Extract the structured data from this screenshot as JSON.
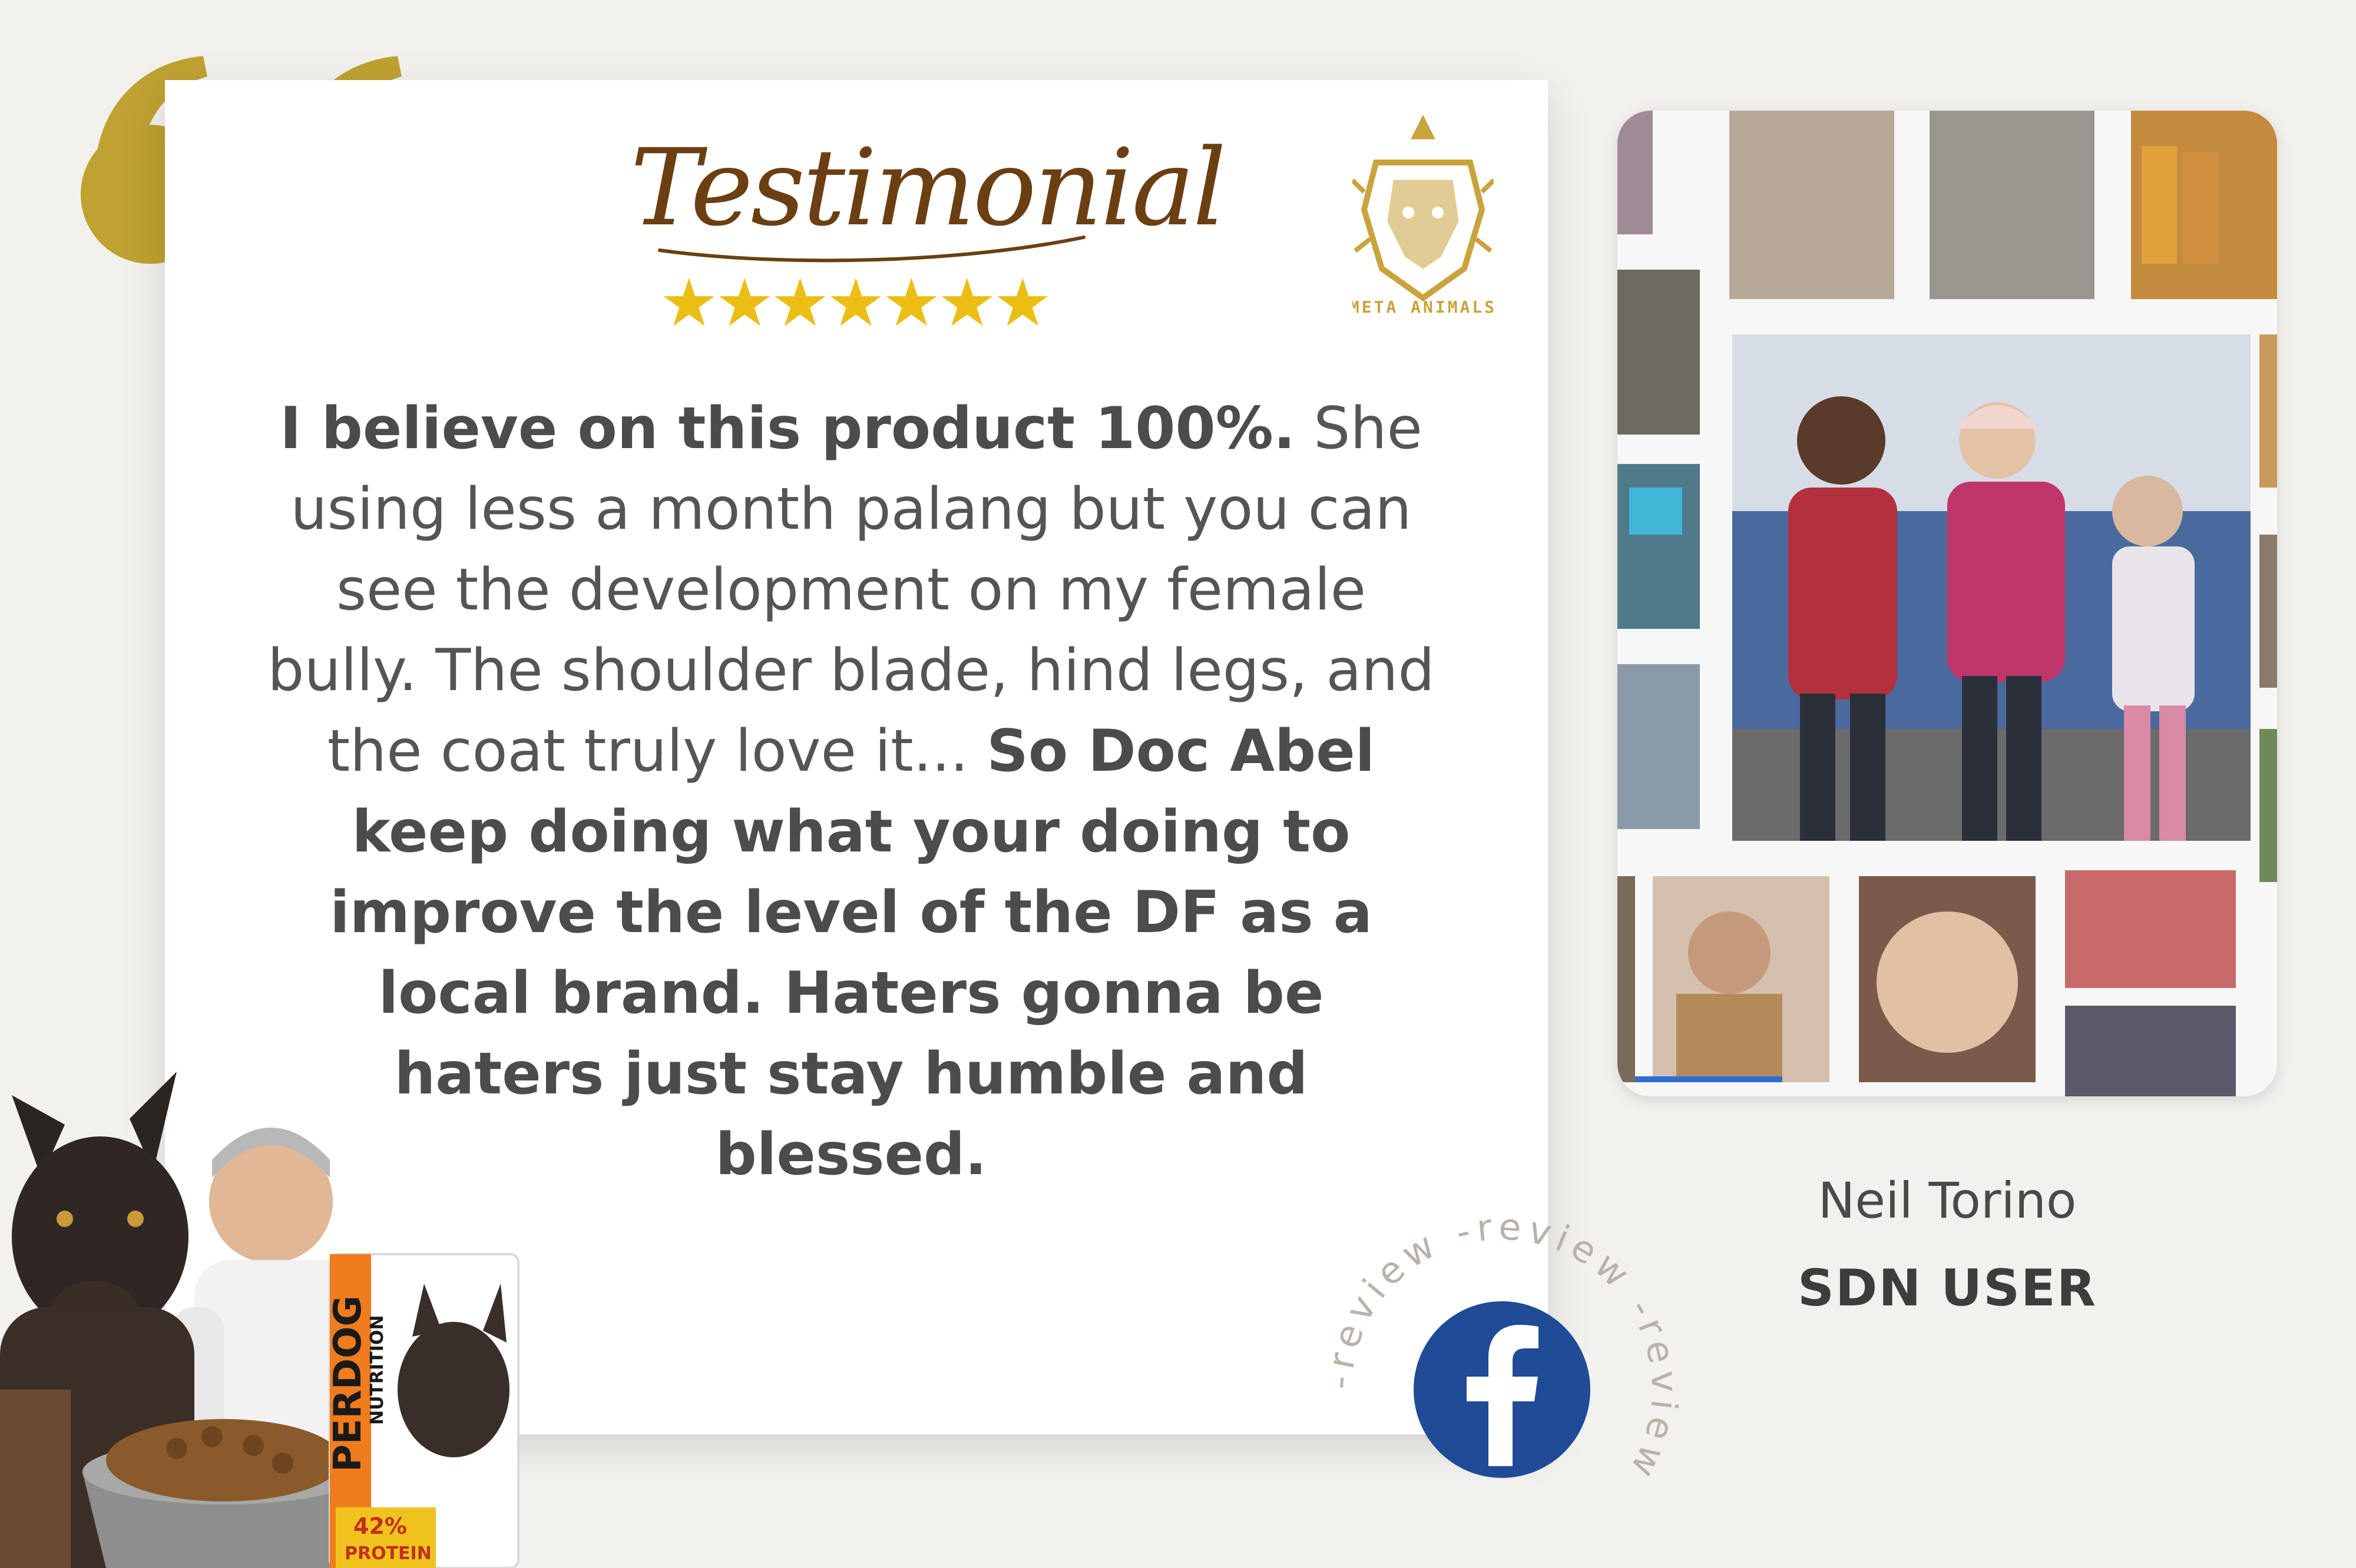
{
  "header": {
    "title": "Testimonial",
    "rating": "★★★★★★★"
  },
  "brand": {
    "logo_text": "META ANIMALS",
    "gold": "#bfa232",
    "star_color": "#ecbd12"
  },
  "testimonial": {
    "part1_bold": "I believe on this product 100%.",
    "part2": " She using less a month palang but you can see the development on my female bully. The shoulder blade, hind legs, and the coat truly love it... ",
    "part3_bold": "So Doc Abel keep doing what your doing to improve the level of the DF as a local brand. Haters gonna be haters just stay humble and blessed."
  },
  "reviewer": {
    "name": "Neil Torino",
    "role": "SDN USER"
  },
  "badge": {
    "ring_text": "-review -review -review ",
    "icon": "facebook-icon",
    "color": "#1f4b97"
  },
  "product": {
    "brand_text": "PERDOG",
    "sub_text": "NUTRITION",
    "protein": "42%",
    "protein_label": "PROTEIN"
  }
}
